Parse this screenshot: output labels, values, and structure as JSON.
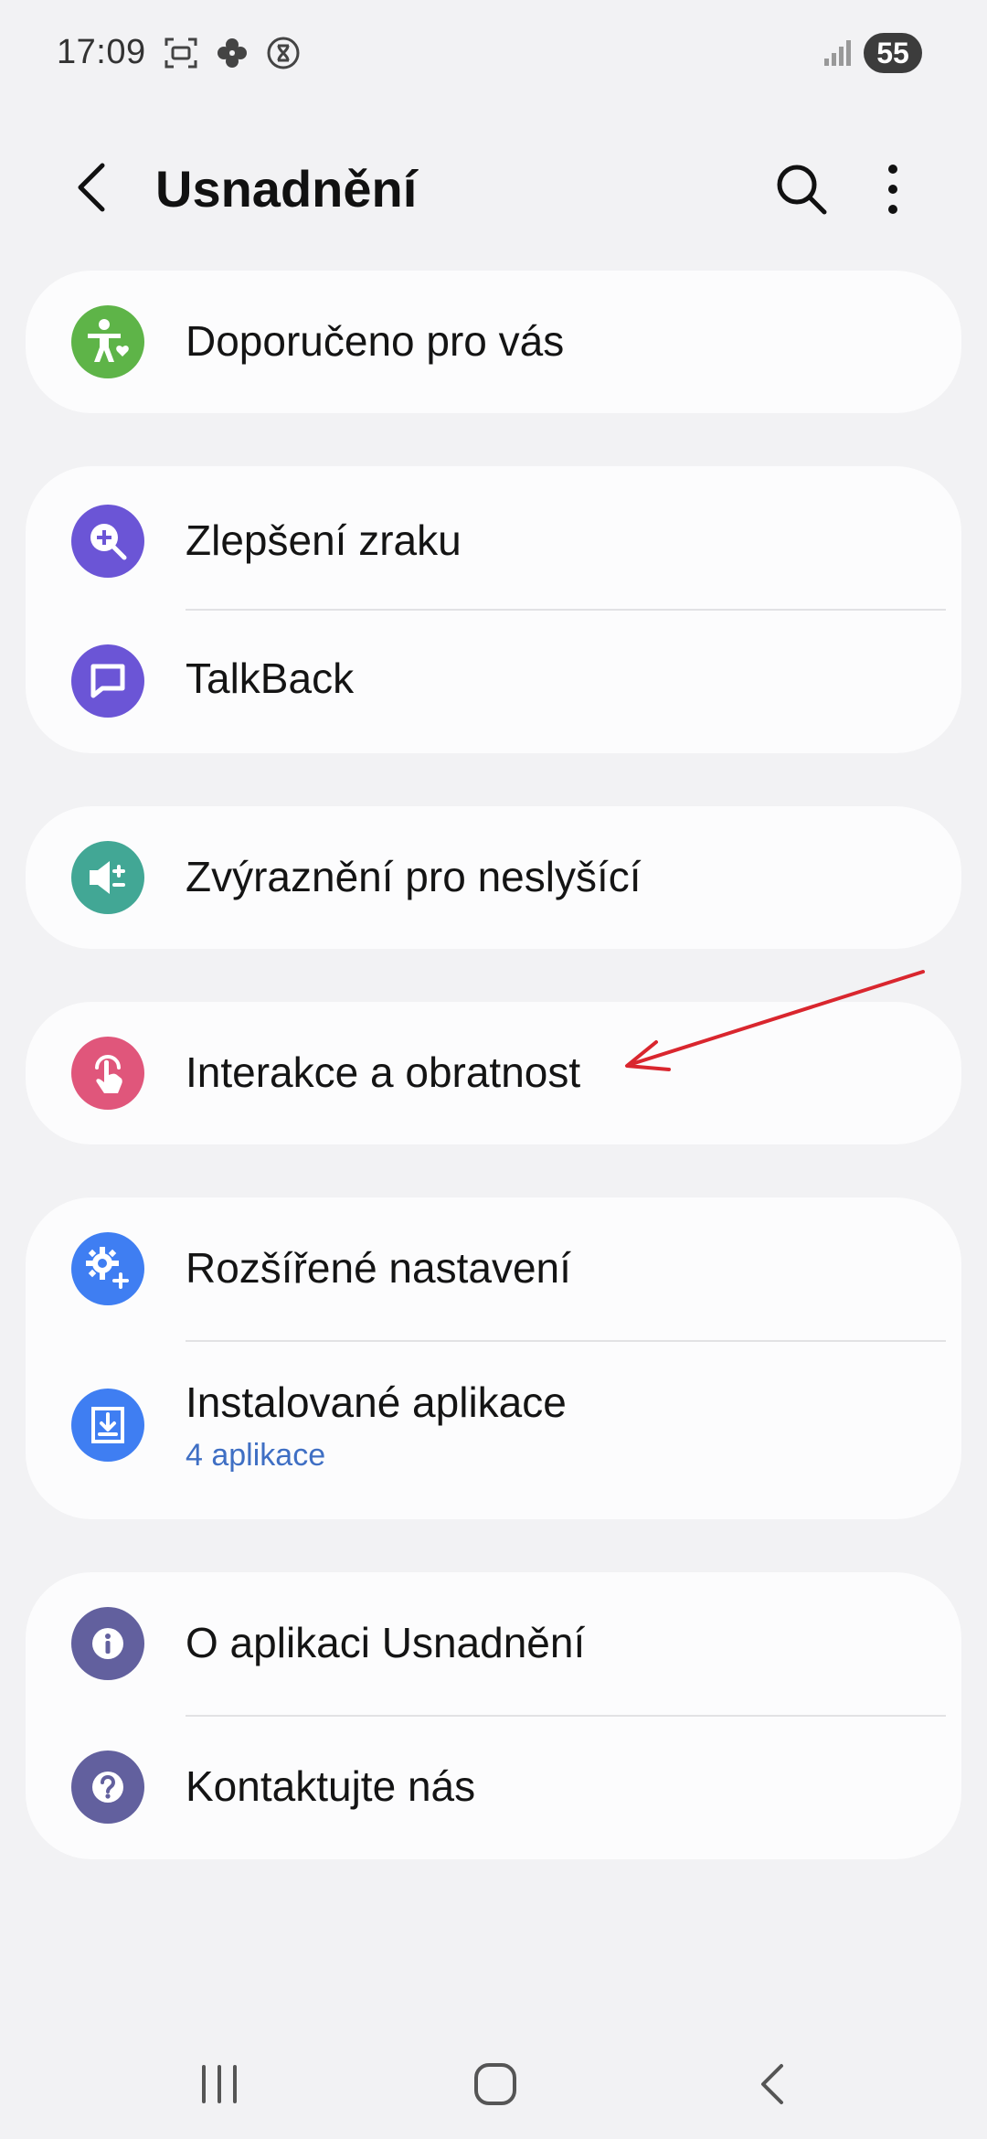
{
  "status_bar": {
    "time": "17:09",
    "battery": "55",
    "icons": [
      "screenshot-icon",
      "pinwheel-icon",
      "digital-wellbeing-icon"
    ]
  },
  "header": {
    "title": "Usnadnění",
    "icons": [
      "back-arrow-icon",
      "search-icon",
      "more-vertical-icon"
    ]
  },
  "menu": {
    "recommended": {
      "label": "Doporučeno pro vás",
      "icon": "accessibility-heart-icon",
      "color": "#5eb448"
    },
    "vision": {
      "label": "Zlepšení zraku",
      "icon": "magnify-plus-icon",
      "color": "#6b55d6"
    },
    "talkback": {
      "label": "TalkBack",
      "icon": "chat-bubble-icon",
      "color": "#6b55d6"
    },
    "hearing": {
      "label": "Zvýraznění pro neslyšící",
      "icon": "speaker-plus-icon",
      "color": "#42a795"
    },
    "interaction": {
      "label": "Interakce a obratnost",
      "icon": "touch-hand-icon",
      "color": "#e0567b"
    },
    "advanced": {
      "label": "Rozšířené nastavení",
      "icon": "gear-plus-icon",
      "color": "#3f7ef2"
    },
    "installed": {
      "label": "Instalované aplikace",
      "sublabel": "4 aplikace",
      "icon": "download-icon",
      "color": "#3f7ef2"
    },
    "about": {
      "label": "O aplikaci Usnadnění",
      "icon": "info-icon",
      "color": "#62609e"
    },
    "contact": {
      "label": "Kontaktujte nás",
      "icon": "question-icon",
      "color": "#62609e"
    }
  },
  "annotation": {
    "color": "#d9262e"
  },
  "navbar": {
    "icons": [
      "recents-icon",
      "home-icon",
      "back-icon"
    ]
  }
}
